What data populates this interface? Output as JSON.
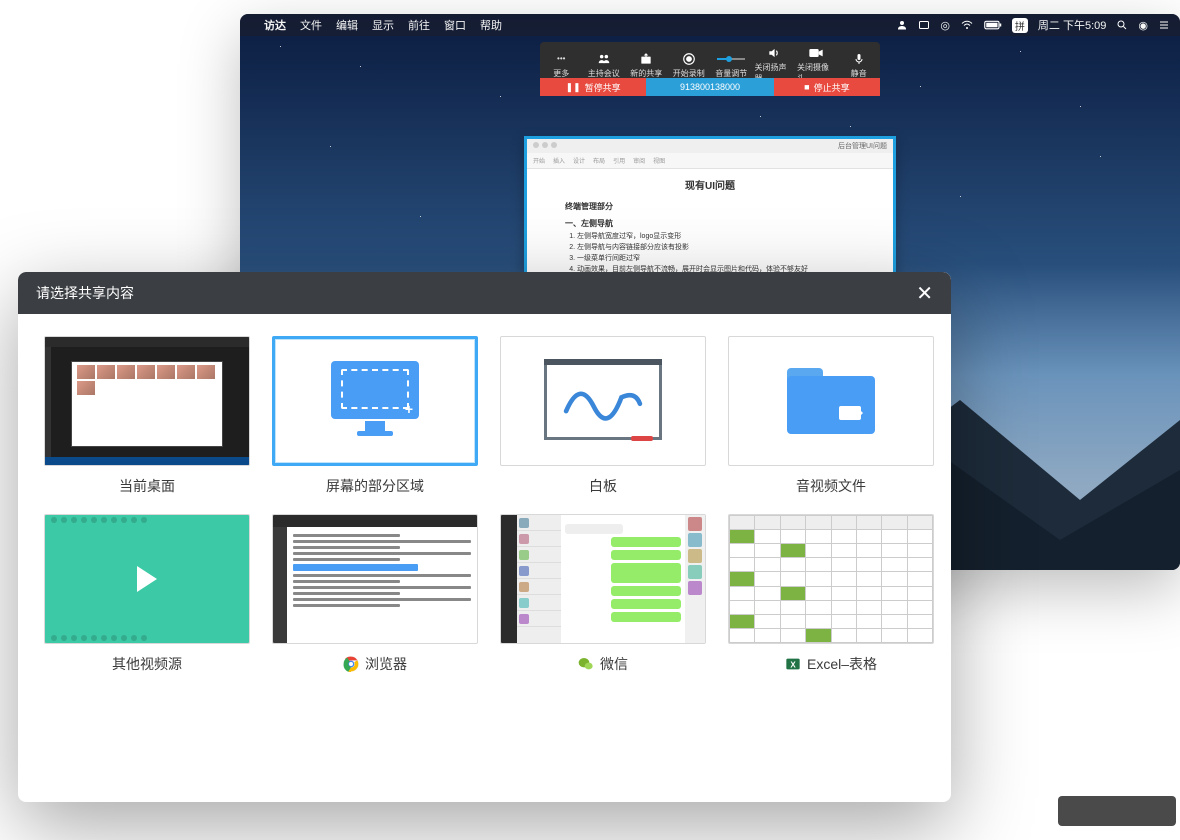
{
  "menubar": {
    "app": "访达",
    "items": [
      "文件",
      "编辑",
      "显示",
      "前往",
      "窗口",
      "帮助"
    ],
    "ime": "拼",
    "clock": "周二 下午5:09"
  },
  "conference": {
    "buttons": [
      {
        "label": "更多"
      },
      {
        "label": "主持会议"
      },
      {
        "label": "新的共享"
      },
      {
        "label": "开始录制"
      },
      {
        "label": "音量调节"
      },
      {
        "label": "关闭扬声器"
      },
      {
        "label": "关闭摄像头"
      },
      {
        "label": "静音"
      }
    ],
    "status": {
      "pause": "暂停共享",
      "id": "913800138000",
      "stop": "停止共享"
    }
  },
  "document": {
    "title": "现有UI问题",
    "toolbar_title": "后台管理UI问题",
    "section": "终端管理部分",
    "sub": "一、左侧导航",
    "items": [
      "左侧导航宽度过窄，logo显示变形",
      "左侧导航与内容链接部分应该有投影",
      "一级菜单行间距过窄",
      "动画效果，目前左侧导航不流畅，展开时会显示图片和代码，体验不够友好"
    ]
  },
  "dialog": {
    "title": "请选择共享内容",
    "items": [
      {
        "label": "当前桌面"
      },
      {
        "label": "屏幕的部分区域"
      },
      {
        "label": "白板"
      },
      {
        "label": "音视频文件"
      },
      {
        "label": "其他视频源"
      },
      {
        "label": "浏览器"
      },
      {
        "label": "微信"
      },
      {
        "label": "Excel–表格"
      }
    ]
  }
}
